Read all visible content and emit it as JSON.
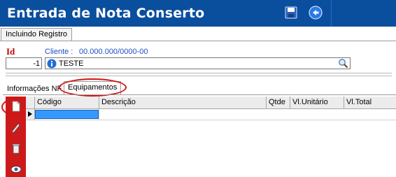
{
  "window": {
    "title": "Entrada de Nota Conserto"
  },
  "toolbar": {
    "save_icon": "floppy-disk-icon",
    "exit_icon": "exit-arrow-icon"
  },
  "subtab": {
    "label": "Incluindo Registro"
  },
  "form": {
    "id_label": "Id",
    "id_value": "-1",
    "cliente_label": "Cliente :",
    "cliente_code": "00.000.000/0000-00",
    "cliente_value": "TESTE"
  },
  "tabs": [
    {
      "label": "Informações NF"
    },
    {
      "label": "Equipamentos"
    }
  ],
  "grid": {
    "columns": [
      "Código",
      "Descrição",
      "Qtde",
      "Vl.Unitário",
      "Vl.Total"
    ]
  },
  "colors": {
    "titlebar": "#0a4e9e",
    "sidebar": "#cc1a1a",
    "highlight": "#d21414",
    "selected_cell": "#3399ff"
  }
}
